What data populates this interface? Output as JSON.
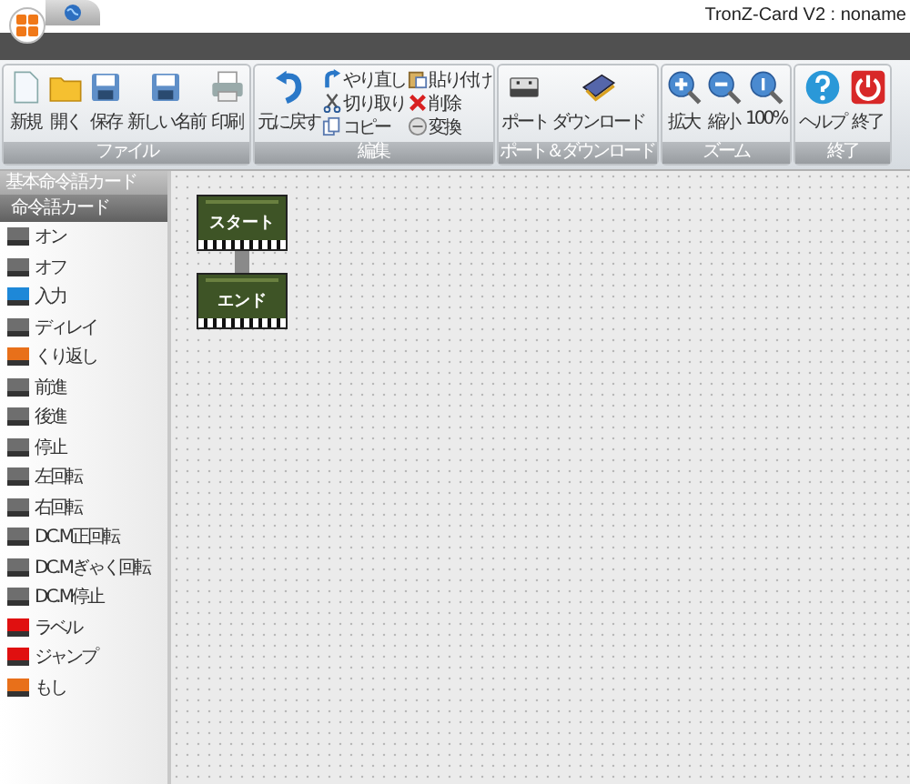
{
  "window": {
    "title": "TronZ-Card V2 : noname"
  },
  "ribbon": [
    {
      "label": "ファイル",
      "large": [
        {
          "label": "新規",
          "kind": "new"
        },
        {
          "label": "開く",
          "kind": "open"
        },
        {
          "label": "保存",
          "kind": "save"
        },
        {
          "label": "新しい名前",
          "kind": "saveas"
        },
        {
          "label": "印刷",
          "kind": "print"
        }
      ]
    },
    {
      "label": "編集",
      "large": [
        {
          "label": "元に戻す",
          "kind": "undo"
        }
      ],
      "small": [
        {
          "label": "やり直し",
          "kind": "redo"
        },
        {
          "label": "切り取り",
          "kind": "cut"
        },
        {
          "label": "コピー",
          "kind": "copy"
        },
        {
          "label": "貼り付け",
          "kind": "paste"
        },
        {
          "label": "削除",
          "kind": "delete"
        },
        {
          "label": "変換",
          "kind": "convert"
        }
      ]
    },
    {
      "label": "ポート＆ダウンロード",
      "large": [
        {
          "label": "ポート",
          "kind": "usb"
        },
        {
          "label": "ダウンロード",
          "kind": "board"
        }
      ]
    },
    {
      "label": "ズーム",
      "large": [
        {
          "label": "拡大",
          "kind": "zoomin"
        },
        {
          "label": "縮小",
          "kind": "zoomout"
        },
        {
          "label": "100%",
          "kind": "zoom100"
        }
      ]
    },
    {
      "label": "終了",
      "large": [
        {
          "label": "ヘルプ",
          "kind": "help"
        },
        {
          "label": "終了",
          "kind": "power"
        }
      ]
    }
  ],
  "sidebar": {
    "header": "基本命令語カード",
    "subheader": "命令語カード",
    "items": [
      {
        "label": "オン",
        "color": "#6e6e6e"
      },
      {
        "label": "オフ",
        "color": "#6e6e6e"
      },
      {
        "label": "入力",
        "color": "#1e88d8"
      },
      {
        "label": "ディレイ",
        "color": "#6e6e6e"
      },
      {
        "label": "くり返し",
        "color": "#e8701a"
      },
      {
        "label": "前進",
        "color": "#6e6e6e"
      },
      {
        "label": "後進",
        "color": "#6e6e6e"
      },
      {
        "label": "停止",
        "color": "#6e6e6e"
      },
      {
        "label": "左回転",
        "color": "#6e6e6e"
      },
      {
        "label": "右回転",
        "color": "#6e6e6e"
      },
      {
        "label": "DC.M正回転",
        "color": "#6e6e6e"
      },
      {
        "label": "DC.Mぎゃく回転",
        "color": "#6e6e6e"
      },
      {
        "label": "DC.M停止",
        "color": "#6e6e6e"
      },
      {
        "label": "ラベル",
        "color": "#e01010"
      },
      {
        "label": "ジャンプ",
        "color": "#e01010"
      },
      {
        "label": "もし",
        "color": "#e8701a"
      }
    ]
  },
  "canvas": {
    "cards": [
      {
        "label": "スタート"
      },
      {
        "label": "エンド"
      }
    ]
  }
}
